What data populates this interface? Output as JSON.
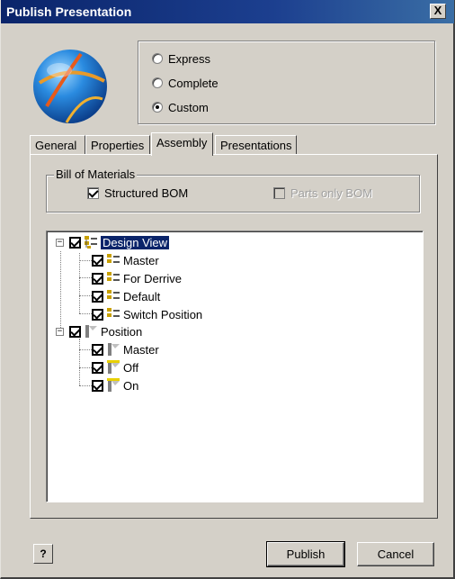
{
  "window": {
    "title": "Publish Presentation",
    "close_glyph": "X"
  },
  "mode_options": [
    {
      "label": "Express",
      "checked": false
    },
    {
      "label": "Complete",
      "checked": false
    },
    {
      "label": "Custom",
      "checked": true
    }
  ],
  "tabs": [
    {
      "label": "General",
      "active": false
    },
    {
      "label": "Properties",
      "active": false
    },
    {
      "label": "Assembly",
      "active": true
    },
    {
      "label": "Presentations",
      "active": false
    }
  ],
  "bom": {
    "group_label": "Bill of Materials",
    "structured_label": "Structured BOM",
    "structured_checked": true,
    "parts_only_label": "Parts only BOM",
    "parts_only_checked": false,
    "parts_only_enabled": false
  },
  "tree": {
    "design_view": {
      "label": "Design View",
      "expander": "−",
      "checked": true,
      "selected": true,
      "children": [
        "Master",
        "For Derrive",
        "Default",
        "Switch Position"
      ]
    },
    "position": {
      "label": "Position",
      "expander": "−",
      "checked": true,
      "children": [
        "Master",
        "Off",
        "On"
      ]
    }
  },
  "buttons": {
    "help_glyph": "?",
    "publish": "Publish",
    "cancel": "Cancel"
  },
  "icons": {
    "globe": "globe-icon",
    "design_view": "design-view-icon",
    "position": "position-icon"
  },
  "colors": {
    "titlebar": "#0a246a",
    "face": "#d4d0c8",
    "selection": "#0a246a",
    "design_view_icon": "#c8a000",
    "position_icon": "#e8d000"
  }
}
